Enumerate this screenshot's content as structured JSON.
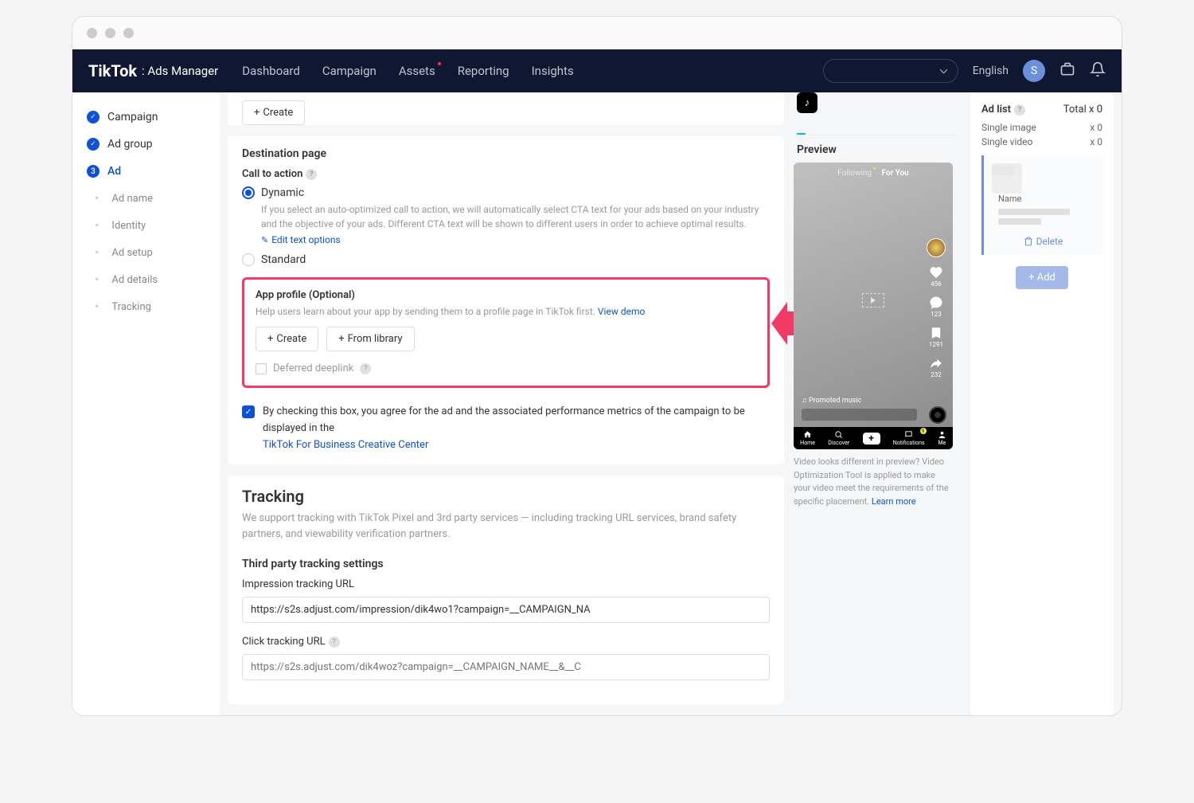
{
  "header": {
    "logo": "TikTok",
    "logo_sub": ": Ads Manager",
    "nav": [
      "Dashboard",
      "Campaign",
      "Assets",
      "Reporting",
      "Insights"
    ],
    "language": "English",
    "avatar_initial": "S"
  },
  "sidebar": {
    "campaign": "Campaign",
    "adgroup": "Ad group",
    "ad": "Ad",
    "ad_number": "3",
    "subitems": [
      "Ad name",
      "Identity",
      "Ad setup",
      "Ad details",
      "Tracking"
    ]
  },
  "main": {
    "create_btn": "Create",
    "dest_title": "Destination page",
    "cta_label": "Call to action",
    "dynamic_label": "Dynamic",
    "dynamic_desc": "If you select an auto-optimized call to action, we will automatically select CTA text for your ads based on your industry and the objective of your ads. Different CTA text will be shown to different users in order to achieve optimal results.",
    "edit_text_options": "Edit text options",
    "standard_label": "Standard",
    "app_profile_title": "App profile (Optional)",
    "app_profile_desc": "Help users learn about your app by sending them to a profile page in TikTok first. ",
    "view_demo": "View demo",
    "create_btn2": "Create",
    "from_library_btn": "From library",
    "deferred_label": "Deferred deeplink",
    "agree_text": "By checking this box, you agree for the ad and the associated performance metrics of the campaign to be displayed in the ",
    "agree_link": "TikTok For Business Creative Center",
    "tracking_title": "Tracking",
    "tracking_desc": "We support tracking with TikTok Pixel and 3rd party services — including tracking URL services, brand safety partners, and viewability verification partners.",
    "third_party_title": "Third party tracking settings",
    "impression_label": "Impression tracking URL",
    "impression_value": "https://s2s.adjust.com/impression/dik4wo1?campaign=__CAMPAIGN_NA",
    "click_label": "Click tracking URL",
    "click_placeholder": "https://s2s.adjust.com/dik4woz?campaign=__CAMPAIGN_NAME__&__C"
  },
  "preview": {
    "title": "Preview",
    "following": "Following",
    "foryou": "For You",
    "likes": "456",
    "comments": "123",
    "saves": "1291",
    "shares": "232",
    "music": "♫ Promoted music",
    "nav_home": "Home",
    "nav_discover": "Discover",
    "nav_notif": "Notifications",
    "nav_me": "Me",
    "nav_badge": "9",
    "note": "Video looks different in preview? Video Optimization Tool is applied to make your video meet the requirements of the specific placement. ",
    "learn_more": "Learn more"
  },
  "adlist": {
    "title": "Ad list",
    "total_label": "Total x 0",
    "single_image": "Single image",
    "single_image_val": "x 0",
    "single_video": "Single video",
    "single_video_val": "x 0",
    "name": "Name",
    "delete": "Delete",
    "add": "+ Add"
  }
}
